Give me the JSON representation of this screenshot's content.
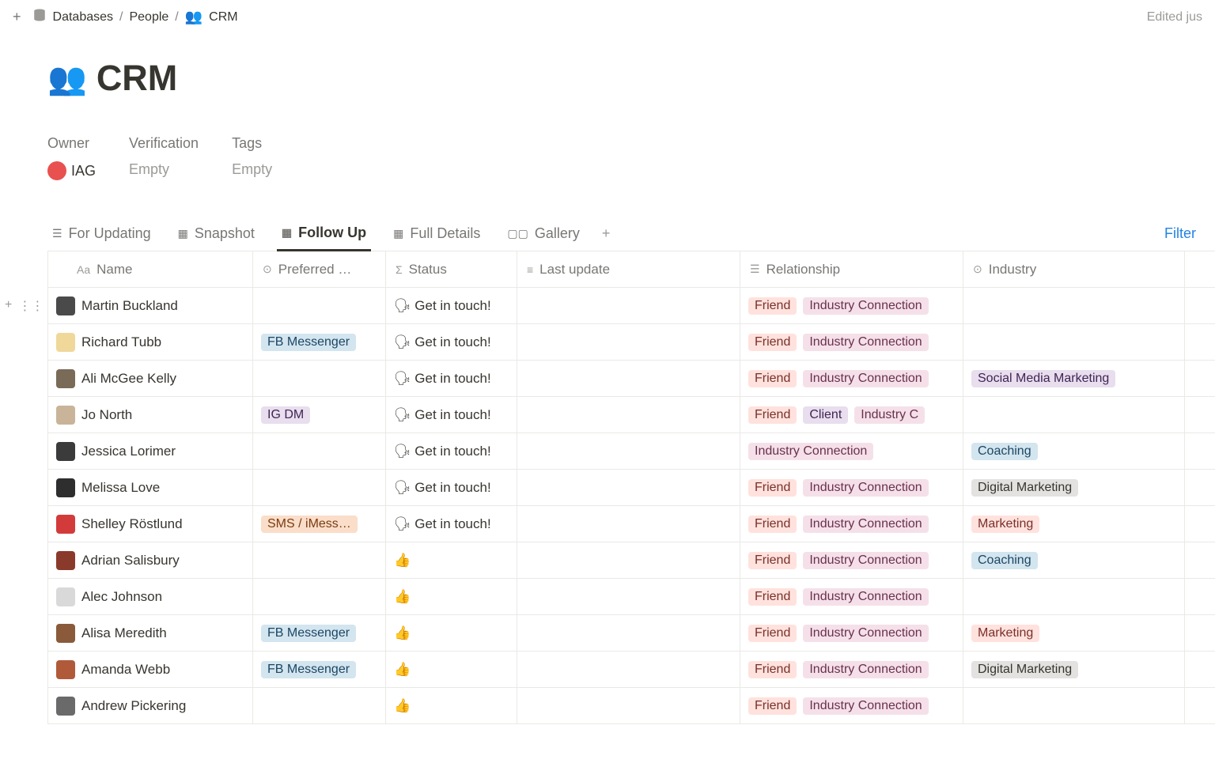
{
  "breadcrumb": {
    "root": "Databases",
    "mid": "People",
    "leaf": "CRM"
  },
  "edited": "Edited jus",
  "title": "CRM",
  "meta": {
    "owner_label": "Owner",
    "owner_value": "IAG",
    "verification_label": "Verification",
    "verification_value": "Empty",
    "tags_label": "Tags",
    "tags_value": "Empty"
  },
  "views": {
    "updating": "For Updating",
    "snapshot": "Snapshot",
    "followup": "Follow Up",
    "fulldetails": "Full Details",
    "gallery": "Gallery"
  },
  "filter": "Filter",
  "columns": {
    "name": "Name",
    "preferred": "Preferred …",
    "status": "Status",
    "last": "Last update",
    "relationship": "Relationship",
    "industry": "Industry"
  },
  "status_labels": {
    "get_in_touch": "Get in touch!"
  },
  "tags": {
    "fb": "FB Messenger",
    "ig": "IG DM",
    "sms": "SMS / iMess…",
    "friend": "Friend",
    "ic": "Industry Connection",
    "ic_trunc": "Industry C",
    "client": "Client",
    "smm": "Social Media Marketing",
    "coach": "Coaching",
    "dm": "Digital Marketing",
    "mktg": "Marketing"
  },
  "rows": [
    {
      "name": "Martin Buckland",
      "pref": null,
      "status": "get",
      "rel": [
        "friend",
        "ic"
      ],
      "ind": [],
      "av": "#4a4a4a"
    },
    {
      "name": "Richard Tubb",
      "pref": "fb",
      "status": "get",
      "rel": [
        "friend",
        "ic"
      ],
      "ind": [],
      "av": "#f0d89a"
    },
    {
      "name": "Ali McGee Kelly",
      "pref": null,
      "status": "get",
      "rel": [
        "friend",
        "ic"
      ],
      "ind": [
        "smm"
      ],
      "av": "#7a6a58"
    },
    {
      "name": "Jo North",
      "pref": "ig",
      "status": "get",
      "rel": [
        "friend",
        "client",
        "ic_trunc"
      ],
      "ind": [],
      "av": "#c9b49a"
    },
    {
      "name": "Jessica Lorimer",
      "pref": null,
      "status": "get",
      "rel": [
        "ic_full"
      ],
      "ind": [
        "coach"
      ],
      "av": "#3b3b3b"
    },
    {
      "name": "Melissa Love",
      "pref": null,
      "status": "get",
      "rel": [
        "friend",
        "ic"
      ],
      "ind": [
        "dm"
      ],
      "av": "#2e2e2e"
    },
    {
      "name": "Shelley Röstlund",
      "pref": "sms",
      "status": "get",
      "rel": [
        "friend",
        "ic"
      ],
      "ind": [
        "mktg"
      ],
      "av": "#d33b3b"
    },
    {
      "name": "Adrian Salisbury",
      "pref": null,
      "status": "thumb",
      "rel": [
        "friend",
        "ic"
      ],
      "ind": [
        "coach"
      ],
      "av": "#8a3a2a"
    },
    {
      "name": "Alec Johnson",
      "pref": null,
      "status": "thumb",
      "rel": [
        "friend",
        "ic"
      ],
      "ind": [],
      "av": "#d9d9d9"
    },
    {
      "name": "Alisa Meredith",
      "pref": "fb",
      "status": "thumb",
      "rel": [
        "friend",
        "ic"
      ],
      "ind": [
        "mktg"
      ],
      "av": "#8a5a3a"
    },
    {
      "name": "Amanda Webb",
      "pref": "fb",
      "status": "thumb",
      "rel": [
        "friend",
        "ic"
      ],
      "ind": [
        "dm"
      ],
      "av": "#b05a3a"
    },
    {
      "name": "Andrew Pickering",
      "pref": null,
      "status": "thumb",
      "rel": [
        "friend",
        "ic"
      ],
      "ind": [],
      "av": "#6a6a6a"
    }
  ]
}
